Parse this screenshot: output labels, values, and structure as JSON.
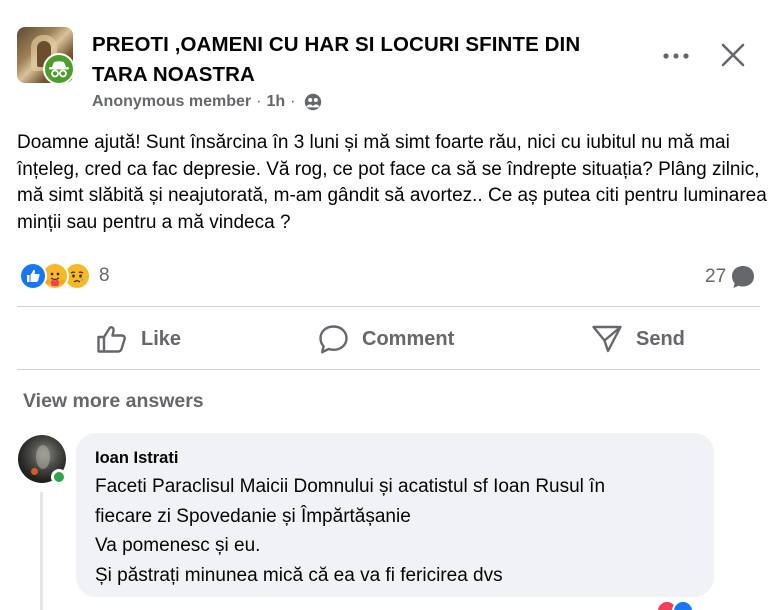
{
  "post": {
    "group_name": "PREOTI ,OAMENI CU HAR SI LOCURI SFINTE DIN TARA NOASTRA",
    "author": "Anonymous member",
    "separator": "·",
    "time": "1h",
    "privacy_icon": "group-privacy-icon",
    "body": "Doamne ajută! Sunt însărcina în 3 luni și mă simt foarte rău, nici cu iubitul nu mă mai înțeleg, cred ca fac depresie. Vă rog, ce pot face ca să se îndrepte situația? Plâng zilnic, mă simt slăbită și neajutorată, m-am gândit să avortez.. Ce aș putea citi pentru luminarea minții sau pentru a mă vindeca ?",
    "reactions": {
      "types": [
        "like",
        "care",
        "sad"
      ],
      "count": "8"
    },
    "comments_count": "27"
  },
  "actions": {
    "like_label": "Like",
    "comment_label": "Comment",
    "send_label": "Send"
  },
  "comments": {
    "view_more_label": "View more answers",
    "items": [
      {
        "author": "Ioan Istrati",
        "online": true,
        "lines": [
          "Faceti Paraclisul Maicii Domnului și acatistul sf Ioan Rusul în",
          "fiecare zi Spovedanie și Împărtășanie",
          "Va pomenesc și eu.",
          "Și păstrați minunea mică că ea va fi fericirea dvs"
        ]
      }
    ]
  },
  "colors": {
    "brand_blue": "#1877f2",
    "secondary_text": "#65676b",
    "online_green": "#31a24c",
    "anonymous_badge": "#4b9e29",
    "bubble_bg": "#f0f2f5"
  }
}
